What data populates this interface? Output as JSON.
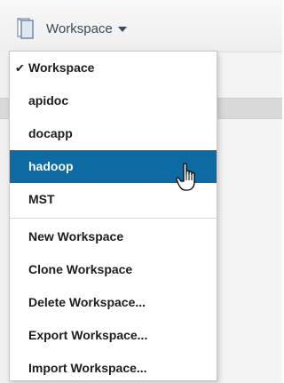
{
  "header": {
    "workspace_label": "Workspace",
    "icon": "workspace-book-icon",
    "caret_icon": "caret-down-icon"
  },
  "menu": {
    "current_workspace": "Workspace",
    "workspaces": [
      "apidoc",
      "docapp",
      "hadoop",
      "MST"
    ],
    "highlighted": "hadoop",
    "actions": [
      "New Workspace",
      "Clone Workspace",
      "Delete Workspace...",
      "Export Workspace...",
      "Import Workspace..."
    ],
    "check_icon": "checkmark-icon"
  },
  "cursor": {
    "icon": "hand-pointer-cursor-icon"
  },
  "colors": {
    "highlight_bg": "#0e6aa3",
    "highlight_text": "#ffffff",
    "menu_text": "#1d1d1d",
    "header_text": "#3a4a5a"
  }
}
